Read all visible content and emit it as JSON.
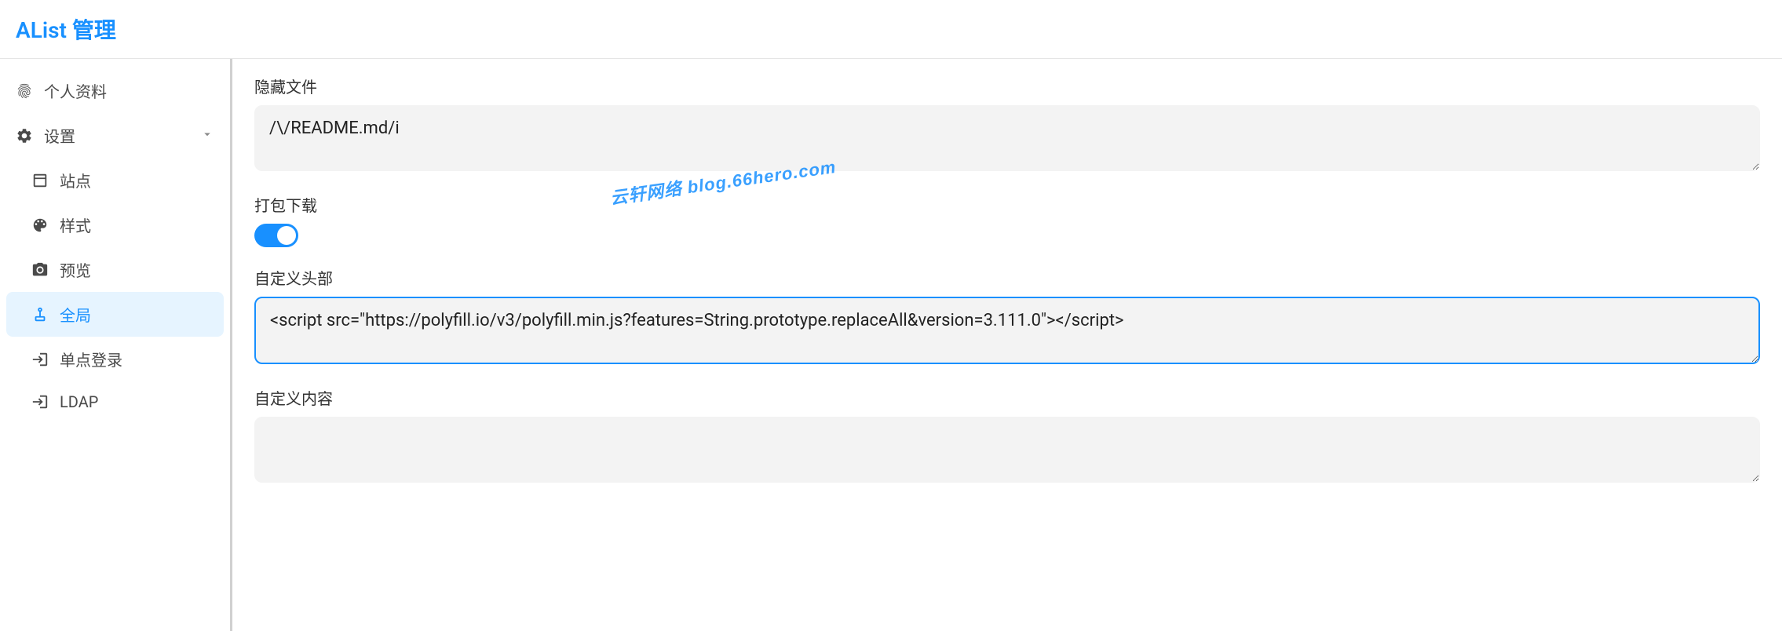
{
  "header": {
    "title": "AList 管理"
  },
  "sidebar": {
    "items": [
      {
        "label": "个人资料"
      },
      {
        "label": "设置"
      },
      {
        "label": "站点"
      },
      {
        "label": "样式"
      },
      {
        "label": "预览"
      },
      {
        "label": "全局"
      },
      {
        "label": "单点登录"
      },
      {
        "label": "LDAP"
      }
    ]
  },
  "fields": {
    "hidden_files": {
      "label": "隐藏文件",
      "value": "/\\/README.md/i"
    },
    "package_download": {
      "label": "打包下载",
      "value": true
    },
    "custom_head": {
      "label": "自定义头部",
      "value": "<script src=\"https://polyfill.io/v3/polyfill.min.js?features=String.prototype.replaceAll&version=3.111.0\"></script>"
    },
    "custom_content": {
      "label": "自定义内容",
      "value": ""
    }
  },
  "watermark": "云轩网络 blog.66hero.com"
}
